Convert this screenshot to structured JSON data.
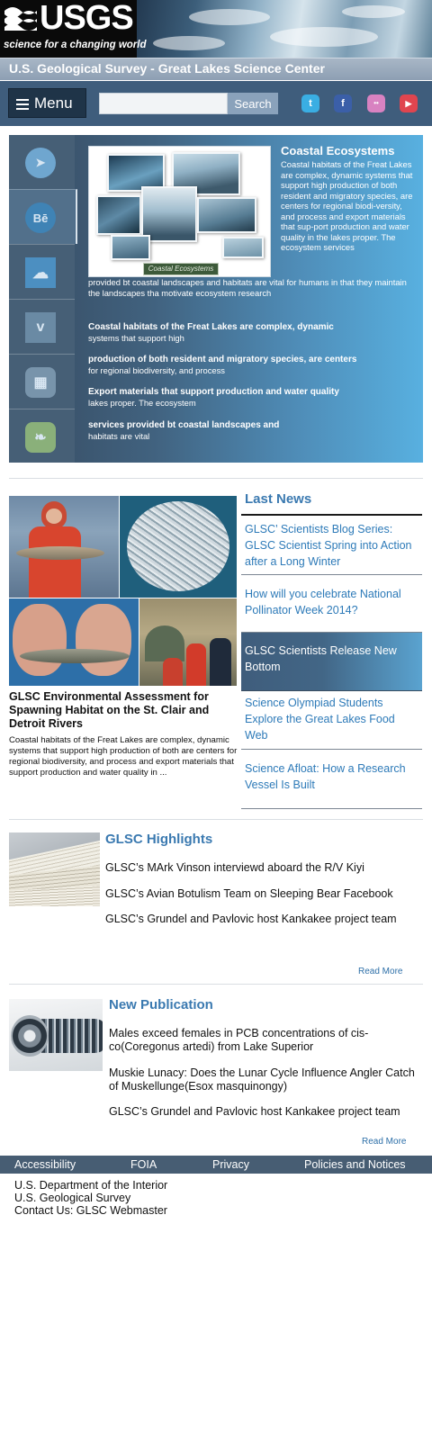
{
  "header": {
    "logo_text": "USGS",
    "tagline": "science for a changing world",
    "site_title": "U.S. Geological Survey - Great Lakes Science Center"
  },
  "nav": {
    "menu_label": "Menu",
    "search_value": "",
    "search_button": "Search",
    "social_icons": [
      "twitter-icon",
      "facebook-icon",
      "flickr-icon",
      "youtube-icon"
    ],
    "social_glyphs": [
      "t",
      "f",
      "••",
      "▶"
    ],
    "social_colors": [
      "#3aaee3",
      "#3b5fa8",
      "#d882c1",
      "#e0454f"
    ]
  },
  "hero": {
    "side_icons": [
      "cursor-icon",
      "behance-icon",
      "cloud-icon",
      "vimeo-icon",
      "windows-icon",
      "leaf-icon"
    ],
    "side_glyphs": [
      "➤",
      "Bē",
      "☁",
      "v",
      "▦",
      "❧"
    ],
    "collage_caption": "Coastal Ecosystems",
    "title": "Coastal Ecosystems",
    "intro": "Coastal habitats of the Freat Lakes are complex, dynamic systems that support high production of both resident and migratory species, are centers for regional biodi-versity, and process and export materials that sup-port production and water quality in the lakes proper. The ecosystem services",
    "intro_cont": "provided bt coastal landscapes and habitats are vital for humans in that they maintain the landscapes tha motivate ecosystem research",
    "points": [
      {
        "bold": "Coastal habitats of the Freat Lakes are complex, dynamic",
        "text": "systems that support high"
      },
      {
        "bold": "production of both resident and migratory species, are centers",
        "text": "for regional biodiversity, and process"
      },
      {
        "bold": "Export materials that support production and water quality",
        "text": "lakes proper. The ecosystem"
      },
      {
        "bold": "services provided bt coastal landscapes and",
        "text": "habitats are vital"
      }
    ]
  },
  "feature": {
    "title": "GLSC Environmental Assessment for Spawning Habitat on the St. Clair and Detroit Rivers",
    "body": "Coastal habitats of the Freat Lakes are complex, dynamic systems that support high production of both are centers for regional biodiversity, and process and export materials that support production and water quality in ..."
  },
  "last_news": {
    "heading": "Last News",
    "items": [
      "GLSC’ Scientists Blog Series: GLSC Scientist Spring into Action after a Long Winter",
      "How will you celebrate National Pollinator Week 2014?",
      "GLSC Scientists Release New Bottom",
      "Science Olympiad Students Explore the Great Lakes Food Web",
      "Science Afloat: How a Research Vessel Is Built"
    ]
  },
  "highlights": {
    "heading": "GLSC Highlights",
    "items": [
      "GLSC’s MArk Vinson interviewd aboard the R/V Kiyi",
      "GLSC’s Avian Botulism Team on Sleeping Bear Facebook",
      "GLSC’s Grundel and Pavlovic host Kankakee project team"
    ],
    "read_more": "Read More"
  },
  "publication": {
    "heading": "New Publication",
    "items": [
      "Males exceed females in PCB concentrations of cis-co(Coregonus artedi) from Lake Superior",
      "Muskie Lunacy: Does the Lunar Cycle Influence Angler Catch of Muskellunge(Esox masquinongy)",
      "GLSC’s Grundel and Pavlovic host Kankakee project team"
    ],
    "read_more": "Read More"
  },
  "footer": {
    "links": [
      "Accessibility",
      "FOIA",
      "Privacy",
      "Policies and Notices"
    ],
    "lines": [
      "U.S. Department of the Interior",
      "U.S. Geological Survey",
      "Contact Us: GLSC Webmaster"
    ]
  }
}
